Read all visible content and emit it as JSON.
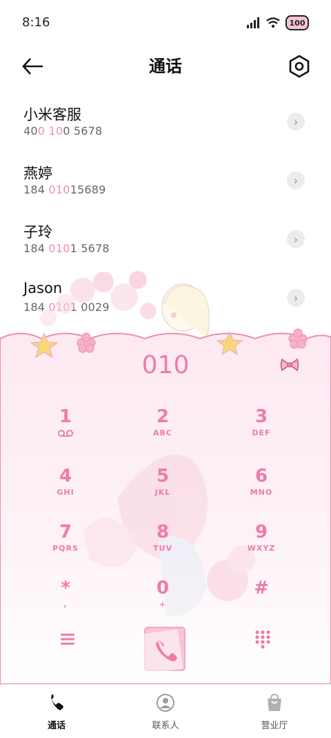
{
  "status": {
    "time": "8:16",
    "battery": "100"
  },
  "header": {
    "title": "通话"
  },
  "contacts": [
    {
      "name": "小米客服",
      "num_parts": [
        "40",
        "0",
        " ",
        "10",
        "0 5678"
      ]
    },
    {
      "name": "燕婷",
      "num_parts": [
        "184 ",
        "010",
        "15689",
        "",
        ""
      ]
    },
    {
      "name": "子玲",
      "num_parts": [
        "184 ",
        "010",
        "1 5678",
        "",
        ""
      ]
    },
    {
      "name": "Jason",
      "num_parts": [
        "184 ",
        "010",
        "1 0029",
        "",
        ""
      ]
    }
  ],
  "dialer": {
    "input": "010",
    "keys": [
      {
        "digit": "1",
        "letters": ""
      },
      {
        "digit": "2",
        "letters": "ABC"
      },
      {
        "digit": "3",
        "letters": "DEF"
      },
      {
        "digit": "4",
        "letters": "GHI"
      },
      {
        "digit": "5",
        "letters": "JKL"
      },
      {
        "digit": "6",
        "letters": "MNO"
      },
      {
        "digit": "7",
        "letters": "PQRS"
      },
      {
        "digit": "8",
        "letters": "TUV"
      },
      {
        "digit": "9",
        "letters": "WXYZ"
      },
      {
        "digit": "*",
        "letters": ","
      },
      {
        "digit": "0",
        "letters": "+"
      },
      {
        "digit": "#",
        "letters": ""
      }
    ]
  },
  "nav": [
    {
      "label": "通话",
      "icon": "phone-icon"
    },
    {
      "label": "联系人",
      "icon": "contacts-icon"
    },
    {
      "label": "营业厅",
      "icon": "store-bag-icon"
    }
  ],
  "colors": {
    "accent": "#f07aaa",
    "highlight": "#f28bb5"
  }
}
